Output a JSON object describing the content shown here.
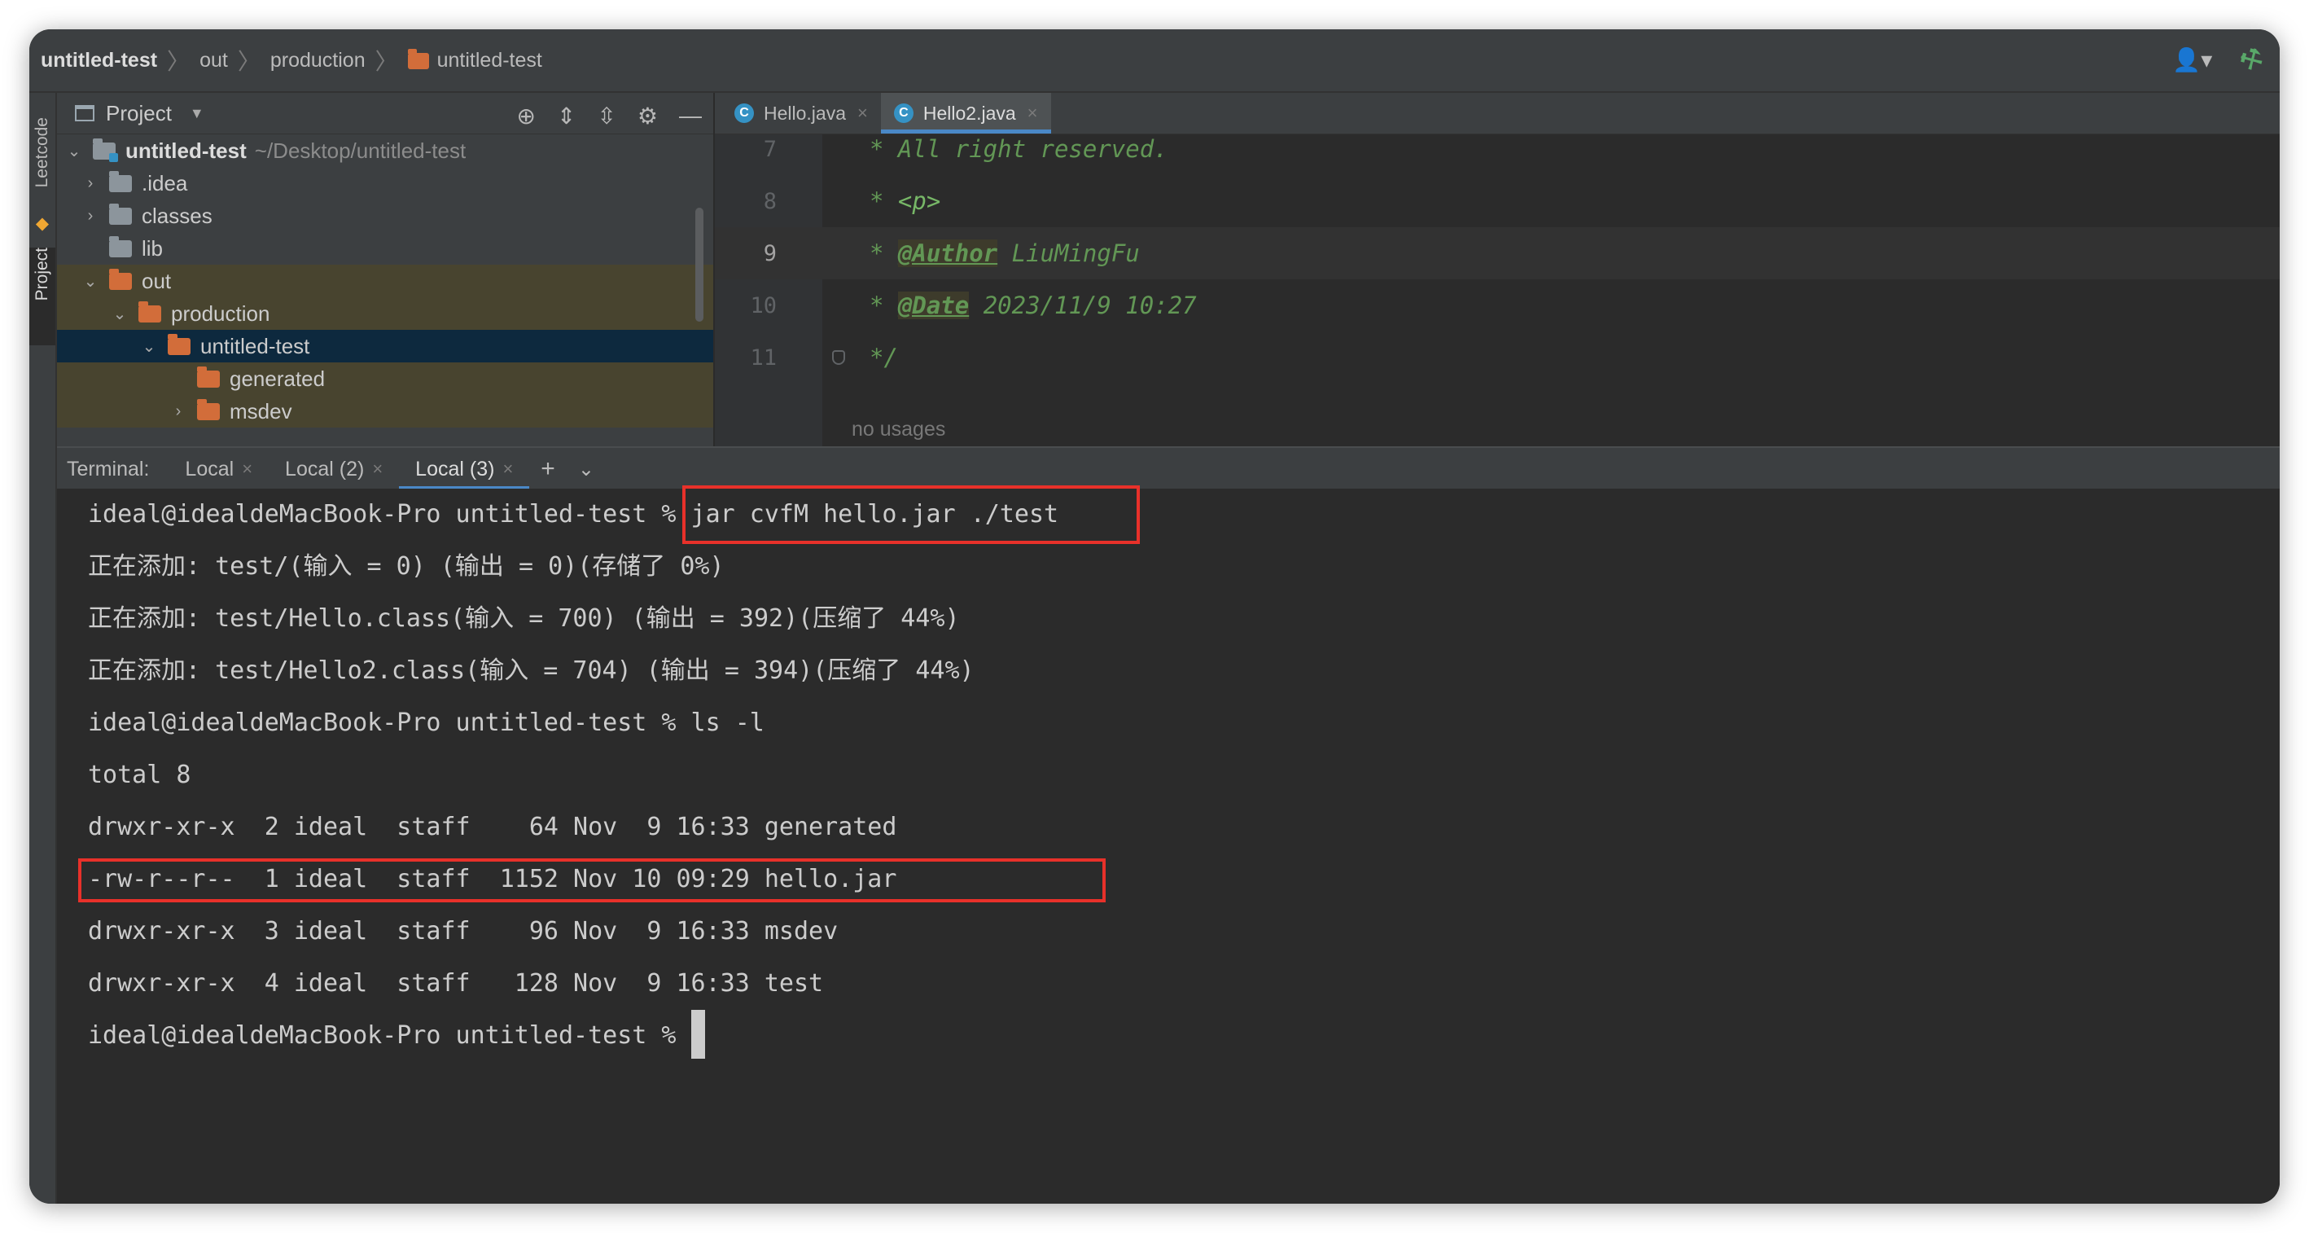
{
  "navbar": {
    "crumbs": [
      "untitled-test",
      "out",
      "production",
      "untitled-test"
    ]
  },
  "toolstrip": {
    "leetcode_label": "Leetcode",
    "project_label": "Project"
  },
  "project": {
    "title": "Project",
    "tree": [
      {
        "label": "untitled-test",
        "path": "~/Desktop/untitled-test"
      },
      {
        "label": ".idea"
      },
      {
        "label": "classes"
      },
      {
        "label": "lib"
      },
      {
        "label": "out"
      },
      {
        "label": "production"
      },
      {
        "label": "untitled-test"
      },
      {
        "label": "generated"
      },
      {
        "label": "msdev"
      }
    ]
  },
  "editor": {
    "tabs": [
      {
        "label": "Hello.java",
        "icon": "C"
      },
      {
        "label": "Hello2.java",
        "icon": "C"
      }
    ],
    "lines": [
      {
        "no": "7",
        "text": "* All right reserved."
      },
      {
        "no": "8",
        "prefix": "* ",
        "tag": "<p>"
      },
      {
        "no": "9",
        "prefix": "* ",
        "doc_tag": "@Author",
        "rest": " LiuMingFu"
      },
      {
        "no": "10",
        "prefix": "* ",
        "doc_tag": "@Date",
        "rest": " 2023/11/9 10:27"
      },
      {
        "no": "11",
        "text": "*/"
      }
    ],
    "no_usages": "no usages"
  },
  "terminal": {
    "label": "Terminal:",
    "tabs": [
      "Local",
      "Local (2)",
      "Local (3)"
    ],
    "lines": [
      {
        "prompt": "ideal@idealdeMacBook-Pro untitled-test % ",
        "cmd": "jar cvfM hello.jar ./test"
      },
      {
        "text": "正在添加: test/(输入 = 0) (输出 = 0)(存储了 0%)"
      },
      {
        "text": "正在添加: test/Hello.class(输入 = 700) (输出 = 392)(压缩了 44%)"
      },
      {
        "text": "正在添加: test/Hello2.class(输入 = 704) (输出 = 394)(压缩了 44%)"
      },
      {
        "text": "ideal@idealdeMacBook-Pro untitled-test % ls -l"
      },
      {
        "text": "total 8"
      },
      {
        "text": "drwxr-xr-x  2 ideal  staff    64 Nov  9 16:33 generated"
      },
      {
        "text": "-rw-r--r--  1 ideal  staff  1152 Nov 10 09:29 hello.jar"
      },
      {
        "text": "drwxr-xr-x  3 ideal  staff    96 Nov  9 16:33 msdev"
      },
      {
        "text": "drwxr-xr-x  4 ideal  staff   128 Nov  9 16:33 test"
      },
      {
        "prompt": "ideal@idealdeMacBook-Pro untitled-test % "
      }
    ]
  },
  "colors": {
    "accent": "#4a88c7",
    "highlight_box": "#e8312a",
    "folder_excluded": "#d26d3a"
  }
}
